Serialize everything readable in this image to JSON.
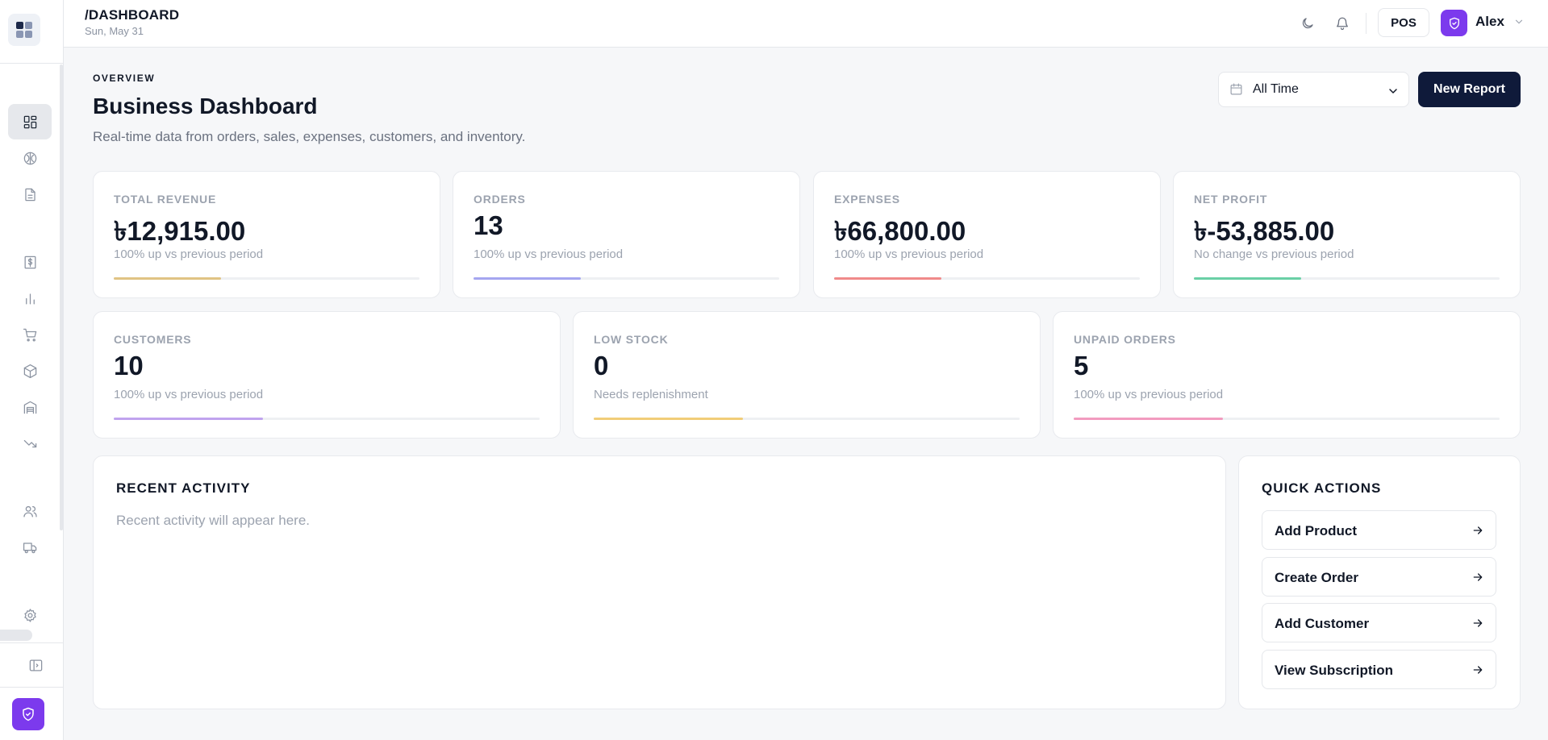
{
  "topbar": {
    "breadcrumb": "/DASHBOARD",
    "date": "Sun, May 31",
    "pos_label": "POS",
    "user_name": "Alex"
  },
  "header": {
    "overline": "OVERVIEW",
    "title": "Business Dashboard",
    "subtitle": "Real-time data from orders, sales, expenses, customers, and inventory.",
    "range_value": "All Time",
    "new_report_label": "New Report"
  },
  "stats_row1": [
    {
      "label": "TOTAL REVENUE",
      "value": "৳12,915.00",
      "note": "100% up vs previous period",
      "progress": 0.35,
      "color": "#e0c384"
    },
    {
      "label": "ORDERS",
      "value": "13",
      "note": "100% up vs previous period",
      "progress": 0.35,
      "color": "#a5a6f0"
    },
    {
      "label": "EXPENSES",
      "value": "৳66,800.00",
      "note": "100% up vs previous period",
      "progress": 0.35,
      "color": "#f08a8a"
    },
    {
      "label": "NET PROFIT",
      "value": "৳-53,885.00",
      "note": "No change vs previous period",
      "progress": 0.35,
      "color": "#6ad0a6"
    }
  ],
  "stats_row2": [
    {
      "label": "CUSTOMERS",
      "value": "10",
      "note": "100% up vs previous period",
      "progress": 0.35,
      "color": "#c0a3ee"
    },
    {
      "label": "LOW STOCK",
      "value": "0",
      "note": "Needs replenishment",
      "progress": 0.35,
      "color": "#f1cd78"
    },
    {
      "label": "UNPAID ORDERS",
      "value": "5",
      "note": "100% up vs previous period",
      "progress": 0.35,
      "color": "#f29bbf"
    }
  ],
  "activity": {
    "title": "RECENT ACTIVITY",
    "empty_text": "Recent activity will appear here."
  },
  "quick_actions": {
    "title": "QUICK ACTIONS",
    "items": [
      {
        "label": "Add Product"
      },
      {
        "label": "Create Order"
      },
      {
        "label": "Add Customer"
      },
      {
        "label": "View Subscription"
      }
    ]
  },
  "sidebar": {
    "items": [
      {
        "icon": "dashboard-icon",
        "active": true
      },
      {
        "icon": "brain-icon"
      },
      {
        "icon": "document-icon"
      },
      {
        "icon": "dollar-receipt-icon"
      },
      {
        "icon": "bar-chart-icon"
      },
      {
        "icon": "cart-icon"
      },
      {
        "icon": "package-icon"
      },
      {
        "icon": "warehouse-icon"
      },
      {
        "icon": "trending-down-icon"
      },
      {
        "icon": "users-icon"
      },
      {
        "icon": "truck-icon"
      },
      {
        "icon": "gear-icon"
      }
    ]
  },
  "colors": {
    "accent": "#7c3aed",
    "primary_button": "#0f1a3a"
  }
}
